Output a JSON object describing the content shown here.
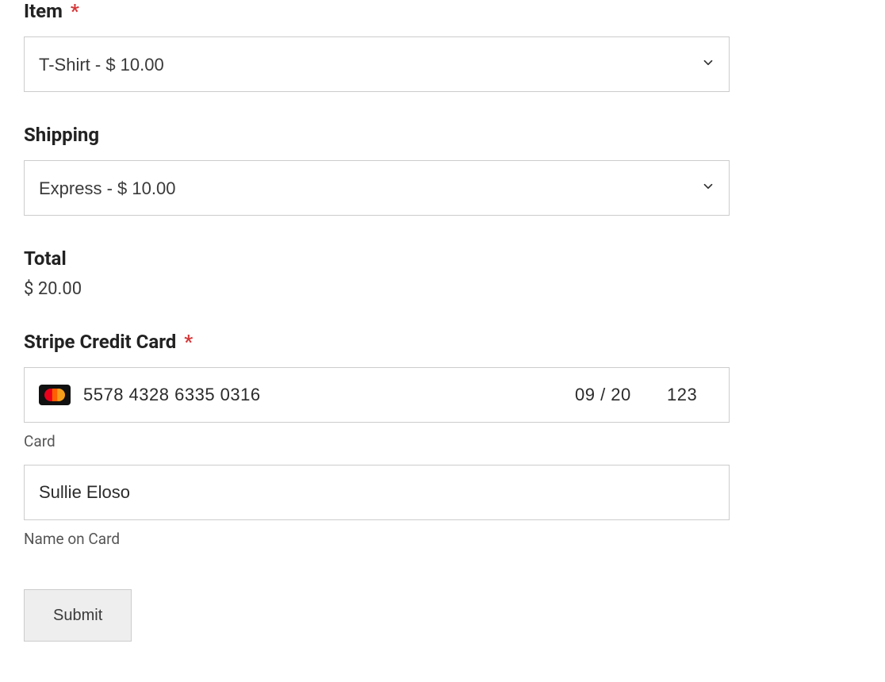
{
  "item": {
    "label": "Item",
    "required": "*",
    "value": "T-Shirt - $ 10.00"
  },
  "shipping": {
    "label": "Shipping",
    "value": "Express - $ 10.00"
  },
  "total": {
    "label": "Total",
    "value": "$ 20.00"
  },
  "stripe": {
    "label": "Stripe Credit Card",
    "required": "*",
    "card_number": "5578 4328 6335 0316",
    "expiry": "09 / 20",
    "cvc": "123",
    "sublabel_card": "Card",
    "name_value": "Sullie Eloso",
    "sublabel_name": "Name on Card"
  },
  "submit_label": "Submit"
}
